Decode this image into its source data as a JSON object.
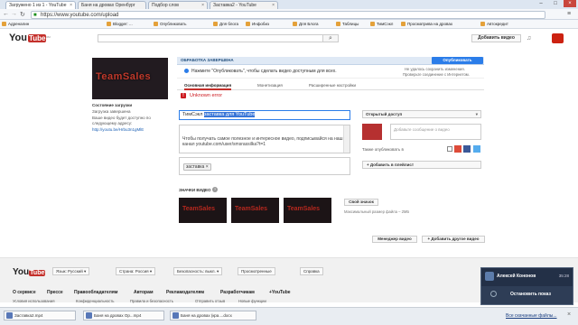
{
  "browser": {
    "tabs": [
      {
        "title": "Загружено 1 из 1 - YouTube",
        "active": true
      },
      {
        "title": "Баня на дровах Оренбург",
        "active": false
      },
      {
        "title": "Подбор слов",
        "active": false
      },
      {
        "title": "Заставка2 - YouTube",
        "active": false
      }
    ],
    "url": "https://www.youtube.com/upload",
    "bookmarks": [
      "Адреналин",
      "Blogger: ...",
      "Опубликовать",
      "Для блога",
      "Инфобиз",
      "Для Блога",
      "Таблицы",
      "ТимСэкл",
      "Просматрива на дровах",
      "Автокредит"
    ]
  },
  "youtube": {
    "logo_you": "You",
    "logo_tube": "Tube",
    "logo_region": "RU",
    "upload_button": "Добавить видео"
  },
  "sidebar": {
    "thumb_text": "TeamSales",
    "status_title": "Состояние загрузки",
    "status_value": "Загрузка завершена",
    "link_caption": "Ваше видео будет доступно по следующему адресу:",
    "video_link": "http://youtu.be/Hrbu3n1gMlE"
  },
  "upload": {
    "status_label": "ОБРАБОТКА ЗАВЕРШЕНА",
    "publish_button": "Опубликовать",
    "info_text": "Нажмите \"Опубликовать\", чтобы сделать видео доступным для всех.",
    "save_note_1": "Не удалось сохранить изменения.",
    "save_note_2": "Проверьте соединение с Интернетом.",
    "tabs": [
      "Основная информация",
      "Монетизация",
      "Расширенные настройки"
    ],
    "error_text": "Unknown error",
    "title_prefix": "ТимСэкл ",
    "title_selected": "заставка для YouTube",
    "description": "Чтобы получать самое полезное и интересное видео, подписывайся на наш канал youtube.com/user/smsrassilka?t=1",
    "tag": "заставка",
    "access": "Открытый доступ",
    "comment_placeholder": "Добавьте сообщение о видео",
    "share_label": "Также опубликовать в",
    "add_to_playlist": "+ Добавить в плейлист",
    "thumbnails_label": "ЗНАЧКИ ВИДЕО",
    "thumb_text": "TeamSales",
    "own_thumb_button": "Свой значок",
    "own_thumb_note": "Максимальный размер файла – 2МБ",
    "video_manager": "Менеджер видео",
    "add_more": "+ Добавить другое видео"
  },
  "footer": {
    "language": "Язык: Русский",
    "country": "Страна: Россия",
    "safety": "Безопасность: выкл.",
    "history": "Просмотренные",
    "help": "Справка",
    "links": [
      "О сервисе",
      "Прессе",
      "Правообладателям",
      "Авторам",
      "Рекламодателям",
      "Разработчикам",
      "+YouTube"
    ],
    "links2": [
      "Условия использования",
      "Конфиденциальность",
      "Правила и безопасность",
      "Отправить отзыв",
      "Новые функции"
    ]
  },
  "notification": {
    "name": "Алексей Кононов",
    "time": "35:28",
    "action": "Остановить показ"
  },
  "downloads": {
    "items": [
      "Заставка2.mp4",
      "Баня на дровах Ор...mp4",
      "Баня на дровах (кра....docx"
    ],
    "show_all": "Все скачанные файлы..."
  }
}
